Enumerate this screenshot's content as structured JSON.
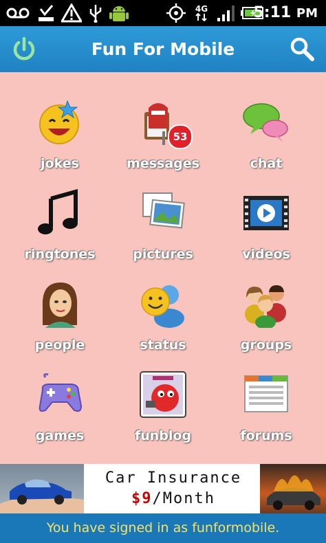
{
  "status_bar": {
    "time": "5:11",
    "ampm": "PM",
    "network": "4G",
    "icons": [
      "voicemail-icon",
      "download-done-icon",
      "warning-icon",
      "usb-icon",
      "android-icon",
      "gps-icon",
      "network-4g-icon",
      "signal-icon",
      "battery-icon"
    ]
  },
  "header": {
    "title": "Fun For Mobile",
    "left_icon": "power-icon",
    "right_icon": "search-icon"
  },
  "grid": {
    "items": [
      {
        "label": "jokes"
      },
      {
        "label": "messages",
        "badge": "53"
      },
      {
        "label": "chat"
      },
      {
        "label": "ringtones"
      },
      {
        "label": "pictures"
      },
      {
        "label": "videos"
      },
      {
        "label": "people"
      },
      {
        "label": "status"
      },
      {
        "label": "groups"
      },
      {
        "label": "games"
      },
      {
        "label": "funblog"
      },
      {
        "label": "forums"
      }
    ]
  },
  "ad": {
    "line1": "Car Insurance",
    "line2_price": "$9",
    "line2_rest": "/Month"
  },
  "footer": {
    "message": "You have signed in as funformobile."
  },
  "colors": {
    "header": "#1f82c2",
    "grid_bg": "#f8c4bd",
    "footer_bg": "#1b78b8",
    "footer_text": "#f3e36a",
    "badge": "#e0202a"
  }
}
